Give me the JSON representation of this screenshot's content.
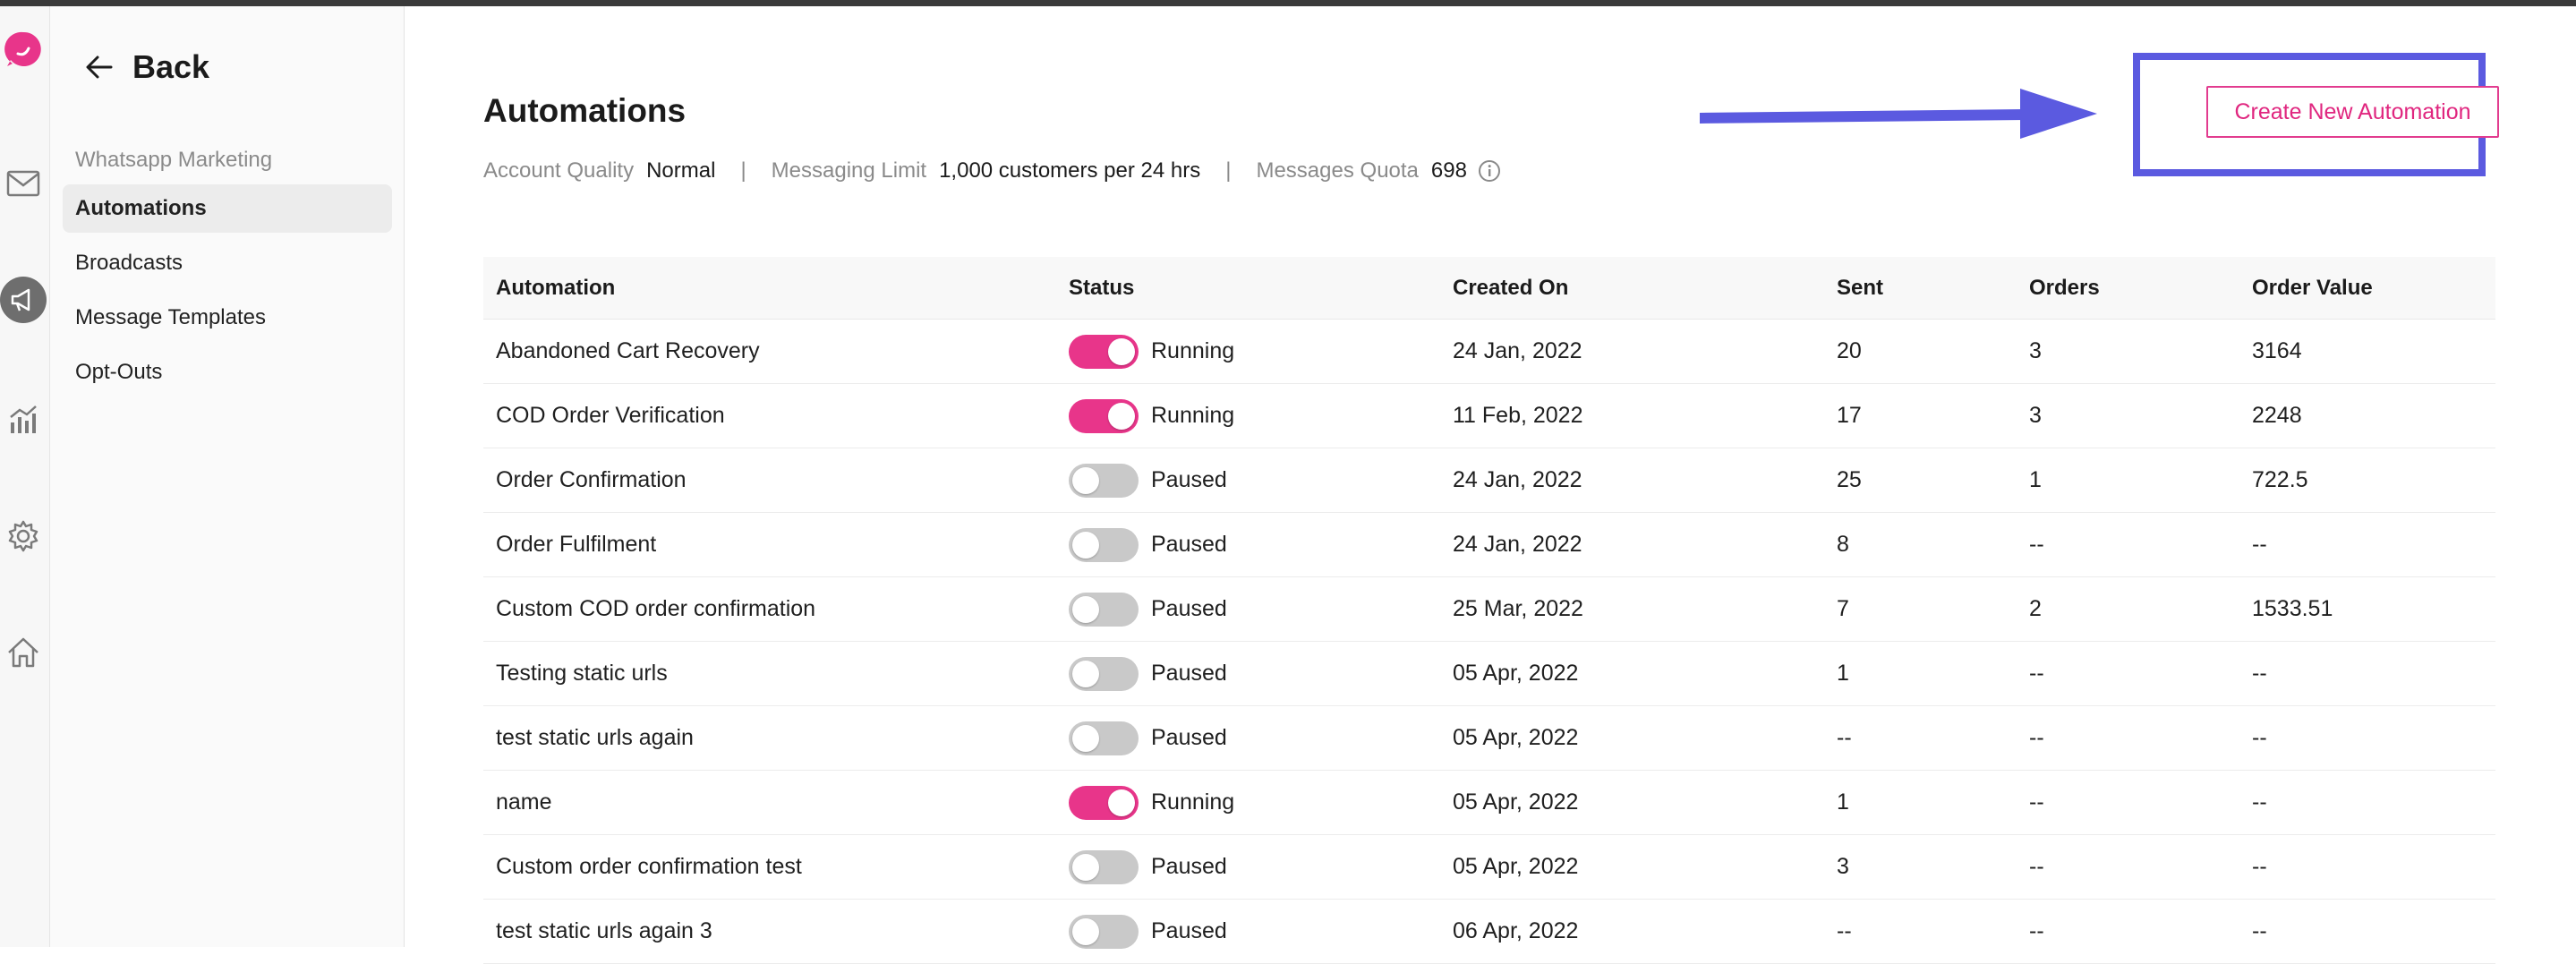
{
  "nav": {
    "back_label": "Back",
    "section_label": "Whatsapp Marketing",
    "items": [
      {
        "label": "Automations",
        "active": true
      },
      {
        "label": "Broadcasts",
        "active": false
      },
      {
        "label": "Message Templates",
        "active": false
      },
      {
        "label": "Opt-Outs",
        "active": false
      }
    ]
  },
  "rail_icons": [
    "logo-icon",
    "mail-icon",
    "megaphone-icon",
    "analytics-icon",
    "gear-icon",
    "home-icon"
  ],
  "page": {
    "title": "Automations",
    "create_button": "Create New Automation",
    "meta": {
      "quality_label": "Account Quality",
      "quality_value": "Normal",
      "limit_label": "Messaging Limit",
      "limit_value": "1,000 customers per 24 hrs",
      "quota_label": "Messages Quota",
      "quota_value": "698",
      "separator": "|"
    }
  },
  "colors": {
    "accent": "#e8358a",
    "highlight": "#5b5ae0",
    "toggle_off": "#c9c9c9"
  },
  "table": {
    "headers": [
      "Automation",
      "Status",
      "Created On",
      "Sent",
      "Orders",
      "Order Value"
    ],
    "rows": [
      {
        "name": "Abandoned Cart Recovery",
        "on": true,
        "status": "Running",
        "created": "24 Jan, 2022",
        "sent": "20",
        "orders": "3",
        "value": "3164"
      },
      {
        "name": "COD Order Verification",
        "on": true,
        "status": "Running",
        "created": "11 Feb, 2022",
        "sent": "17",
        "orders": "3",
        "value": "2248"
      },
      {
        "name": "Order Confirmation",
        "on": false,
        "status": "Paused",
        "created": "24 Jan, 2022",
        "sent": "25",
        "orders": "1",
        "value": "722.5"
      },
      {
        "name": "Order Fulfilment",
        "on": false,
        "status": "Paused",
        "created": "24 Jan, 2022",
        "sent": "8",
        "orders": "--",
        "value": "--"
      },
      {
        "name": "Custom COD order confirmation",
        "on": false,
        "status": "Paused",
        "created": "25 Mar, 2022",
        "sent": "7",
        "orders": "2",
        "value": "1533.51"
      },
      {
        "name": "Testing static urls",
        "on": false,
        "status": "Paused",
        "created": "05 Apr, 2022",
        "sent": "1",
        "orders": "--",
        "value": "--"
      },
      {
        "name": "test static urls again",
        "on": false,
        "status": "Paused",
        "created": "05 Apr, 2022",
        "sent": "--",
        "orders": "--",
        "value": "--"
      },
      {
        "name": "name",
        "on": true,
        "status": "Running",
        "created": "05 Apr, 2022",
        "sent": "1",
        "orders": "--",
        "value": "--"
      },
      {
        "name": "Custom order confirmation test",
        "on": false,
        "status": "Paused",
        "created": "05 Apr, 2022",
        "sent": "3",
        "orders": "--",
        "value": "--"
      },
      {
        "name": "test static urls again 3",
        "on": false,
        "status": "Paused",
        "created": "06 Apr, 2022",
        "sent": "--",
        "orders": "--",
        "value": "--"
      }
    ]
  }
}
